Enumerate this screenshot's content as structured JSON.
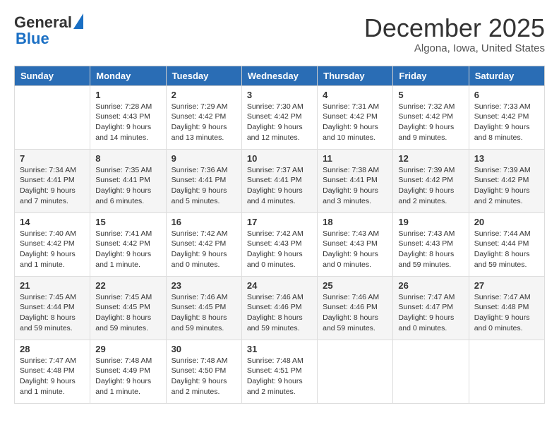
{
  "header": {
    "logo_line1": "General",
    "logo_line2": "Blue",
    "month": "December 2025",
    "location": "Algona, Iowa, United States"
  },
  "weekdays": [
    "Sunday",
    "Monday",
    "Tuesday",
    "Wednesday",
    "Thursday",
    "Friday",
    "Saturday"
  ],
  "weeks": [
    [
      {
        "day": "",
        "sunrise": "",
        "sunset": "",
        "daylight": ""
      },
      {
        "day": "1",
        "sunrise": "7:28 AM",
        "sunset": "4:43 PM",
        "daylight": "9 hours and 14 minutes."
      },
      {
        "day": "2",
        "sunrise": "7:29 AM",
        "sunset": "4:42 PM",
        "daylight": "9 hours and 13 minutes."
      },
      {
        "day": "3",
        "sunrise": "7:30 AM",
        "sunset": "4:42 PM",
        "daylight": "9 hours and 12 minutes."
      },
      {
        "day": "4",
        "sunrise": "7:31 AM",
        "sunset": "4:42 PM",
        "daylight": "9 hours and 10 minutes."
      },
      {
        "day": "5",
        "sunrise": "7:32 AM",
        "sunset": "4:42 PM",
        "daylight": "9 hours and 9 minutes."
      },
      {
        "day": "6",
        "sunrise": "7:33 AM",
        "sunset": "4:42 PM",
        "daylight": "9 hours and 8 minutes."
      }
    ],
    [
      {
        "day": "7",
        "sunrise": "7:34 AM",
        "sunset": "4:41 PM",
        "daylight": "9 hours and 7 minutes."
      },
      {
        "day": "8",
        "sunrise": "7:35 AM",
        "sunset": "4:41 PM",
        "daylight": "9 hours and 6 minutes."
      },
      {
        "day": "9",
        "sunrise": "7:36 AM",
        "sunset": "4:41 PM",
        "daylight": "9 hours and 5 minutes."
      },
      {
        "day": "10",
        "sunrise": "7:37 AM",
        "sunset": "4:41 PM",
        "daylight": "9 hours and 4 minutes."
      },
      {
        "day": "11",
        "sunrise": "7:38 AM",
        "sunset": "4:41 PM",
        "daylight": "9 hours and 3 minutes."
      },
      {
        "day": "12",
        "sunrise": "7:39 AM",
        "sunset": "4:42 PM",
        "daylight": "9 hours and 2 minutes."
      },
      {
        "day": "13",
        "sunrise": "7:39 AM",
        "sunset": "4:42 PM",
        "daylight": "9 hours and 2 minutes."
      }
    ],
    [
      {
        "day": "14",
        "sunrise": "7:40 AM",
        "sunset": "4:42 PM",
        "daylight": "9 hours and 1 minute."
      },
      {
        "day": "15",
        "sunrise": "7:41 AM",
        "sunset": "4:42 PM",
        "daylight": "9 hours and 1 minute."
      },
      {
        "day": "16",
        "sunrise": "7:42 AM",
        "sunset": "4:42 PM",
        "daylight": "9 hours and 0 minutes."
      },
      {
        "day": "17",
        "sunrise": "7:42 AM",
        "sunset": "4:43 PM",
        "daylight": "9 hours and 0 minutes."
      },
      {
        "day": "18",
        "sunrise": "7:43 AM",
        "sunset": "4:43 PM",
        "daylight": "9 hours and 0 minutes."
      },
      {
        "day": "19",
        "sunrise": "7:43 AM",
        "sunset": "4:43 PM",
        "daylight": "8 hours and 59 minutes."
      },
      {
        "day": "20",
        "sunrise": "7:44 AM",
        "sunset": "4:44 PM",
        "daylight": "8 hours and 59 minutes."
      }
    ],
    [
      {
        "day": "21",
        "sunrise": "7:45 AM",
        "sunset": "4:44 PM",
        "daylight": "8 hours and 59 minutes."
      },
      {
        "day": "22",
        "sunrise": "7:45 AM",
        "sunset": "4:45 PM",
        "daylight": "8 hours and 59 minutes."
      },
      {
        "day": "23",
        "sunrise": "7:46 AM",
        "sunset": "4:45 PM",
        "daylight": "8 hours and 59 minutes."
      },
      {
        "day": "24",
        "sunrise": "7:46 AM",
        "sunset": "4:46 PM",
        "daylight": "8 hours and 59 minutes."
      },
      {
        "day": "25",
        "sunrise": "7:46 AM",
        "sunset": "4:46 PM",
        "daylight": "8 hours and 59 minutes."
      },
      {
        "day": "26",
        "sunrise": "7:47 AM",
        "sunset": "4:47 PM",
        "daylight": "9 hours and 0 minutes."
      },
      {
        "day": "27",
        "sunrise": "7:47 AM",
        "sunset": "4:48 PM",
        "daylight": "9 hours and 0 minutes."
      }
    ],
    [
      {
        "day": "28",
        "sunrise": "7:47 AM",
        "sunset": "4:48 PM",
        "daylight": "9 hours and 1 minute."
      },
      {
        "day": "29",
        "sunrise": "7:48 AM",
        "sunset": "4:49 PM",
        "daylight": "9 hours and 1 minute."
      },
      {
        "day": "30",
        "sunrise": "7:48 AM",
        "sunset": "4:50 PM",
        "daylight": "9 hours and 2 minutes."
      },
      {
        "day": "31",
        "sunrise": "7:48 AM",
        "sunset": "4:51 PM",
        "daylight": "9 hours and 2 minutes."
      },
      {
        "day": "",
        "sunrise": "",
        "sunset": "",
        "daylight": ""
      },
      {
        "day": "",
        "sunrise": "",
        "sunset": "",
        "daylight": ""
      },
      {
        "day": "",
        "sunrise": "",
        "sunset": "",
        "daylight": ""
      }
    ]
  ]
}
